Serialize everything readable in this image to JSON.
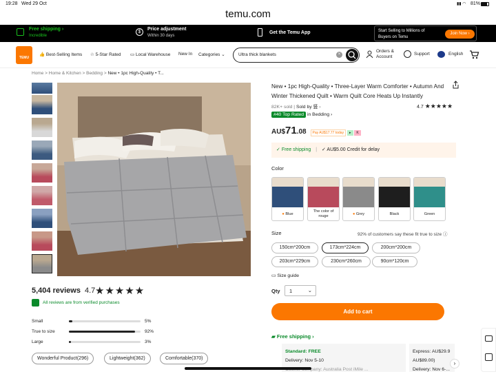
{
  "status": {
    "time": "19:28",
    "date": "Wed 29 Oct",
    "battery": "81%"
  },
  "url": "temu.com",
  "promo": {
    "free_shipping": "Free shipping",
    "free_shipping_sub": "Incredible",
    "price_adj": "Price adjustment",
    "price_adj_sub": "Within 30 days",
    "app": "Get the Temu App",
    "sell_line1": "Start Selling to Millions of",
    "sell_line2": "Buyers on Temu",
    "join": "Join Now"
  },
  "header": {
    "logo": "TEMU",
    "nav": [
      "Best-Selling Items",
      "5-Star Rated",
      "Local Warehouse",
      "New In",
      "Categories"
    ],
    "search_value": "Ultra thick blankets",
    "orders": "Orders &",
    "orders2": "Account",
    "support": "Support",
    "language": "English"
  },
  "breadcrumb": [
    "Home",
    "Home & Kitchen",
    "Bedding",
    "New • 1pc High-Quality • T..."
  ],
  "product": {
    "title": "New • 1pc High-Quality • Three-Layer Warm Comforter • Autumn And Winter Thickened Quilt • Warm Quilt Core Heats Up Instantly",
    "sold": "82K+ sold",
    "sold_by": "Sold by",
    "seller": "竖",
    "rating": "4.7",
    "badge": "#40 Top Rated",
    "badge_cat": "in Bedding",
    "currency": "AU$",
    "price_int": "71",
    "price_dec": ".08",
    "pay_note": "Pay AU$17.77 today",
    "free_ship": "Free shipping",
    "credit": "AU$5.00 Credit for delay",
    "color_label": "Color",
    "colors": [
      "Blue",
      "The color of rouge",
      "Grey",
      "Black",
      "Green"
    ],
    "swatch_colors": [
      "#2f4f7a",
      "#b84a5c",
      "#8a8a8a",
      "#1e1e1e",
      "#2f8f8a"
    ],
    "size_label": "Size",
    "fit_note": "92% of customers say these fit true to size",
    "sizes": [
      "150cm*200cm",
      "173cm*224cm",
      "200cm*200cm",
      "203cm*229cm",
      "230cm*260cm",
      "90cm*120cm"
    ],
    "size_guide": "Size guide",
    "qty_label": "Qty",
    "qty": "1",
    "add_to_cart": "Add to cart",
    "shipping_header": "Free shipping",
    "standard": "Standard: FREE",
    "delivery1": "Delivery: Nov 5-10",
    "courier": "Courier company:",
    "courier_name": "Australia Post",
    "courier2": "iMile ...",
    "express": "Express: AU$29.9",
    "express2": "AU$89.00)",
    "delivery2": "Delivery: Nov 6-..."
  },
  "reviews": {
    "count": "5,404 reviews",
    "rating": "4.7",
    "verified": "All reviews are from verified purchases",
    "fit": [
      {
        "label": "Small",
        "pct": "5%",
        "value": 0.05
      },
      {
        "label": "True to size",
        "pct": "92%",
        "value": 0.92
      },
      {
        "label": "Large",
        "pct": "3%",
        "value": 0.03
      }
    ],
    "chips": [
      "Wonderful Product(296)",
      "Lightweight(362)",
      "Comfortable(370)"
    ]
  }
}
